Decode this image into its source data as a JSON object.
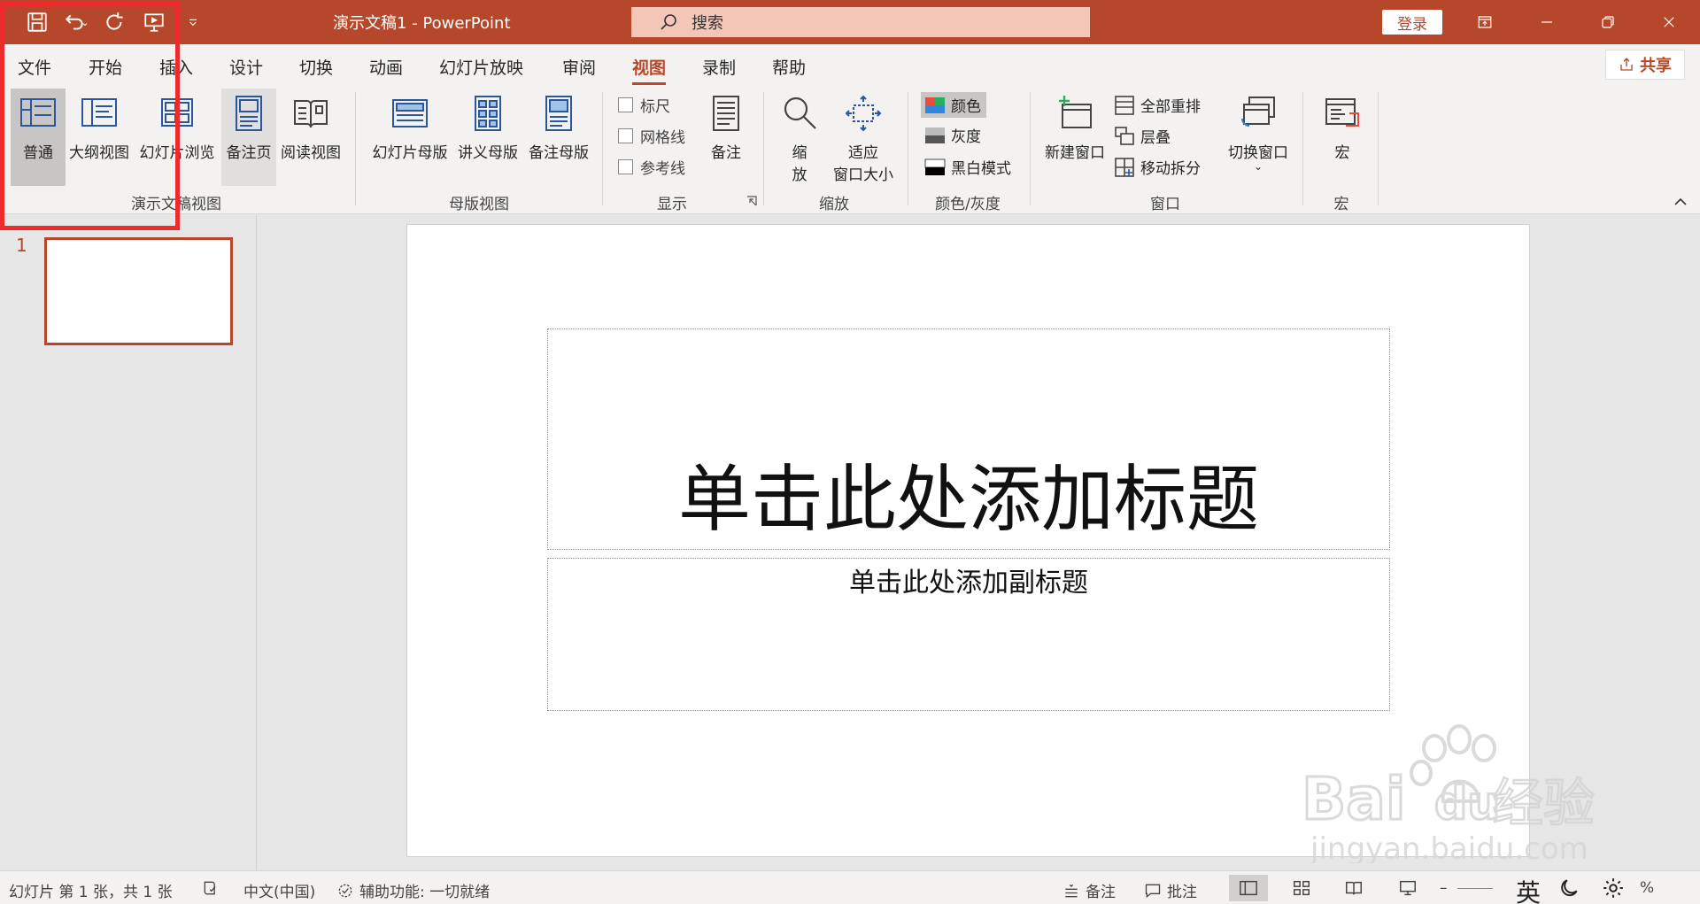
{
  "titlebar": {
    "doc_title": "演示文稿1  -  PowerPoint",
    "search_placeholder": "搜索",
    "login_label": "登录"
  },
  "tabs": [
    {
      "label": "文件"
    },
    {
      "label": "开始"
    },
    {
      "label": "插入"
    },
    {
      "label": "设计"
    },
    {
      "label": "切换"
    },
    {
      "label": "动画"
    },
    {
      "label": "幻灯片放映"
    },
    {
      "label": "审阅"
    },
    {
      "label": "视图",
      "active": true
    },
    {
      "label": "录制"
    },
    {
      "label": "帮助"
    }
  ],
  "share_label": "共享",
  "ribbon": {
    "presentation_views": {
      "label": "演示文稿视图",
      "buttons": [
        "普通",
        "大纲视图",
        "幻灯片浏览",
        "备注页",
        "阅读视图"
      ]
    },
    "master_views": {
      "label": "母版视图",
      "buttons": [
        "幻灯片母版",
        "讲义母版",
        "备注母版"
      ]
    },
    "show": {
      "label": "显示",
      "checkboxes": [
        "标尺",
        "网格线",
        "参考线"
      ],
      "notes_button": "备注"
    },
    "zoom": {
      "label": "缩放",
      "zoom_button_line1": "缩",
      "zoom_button_line2": "放",
      "fit_button_line1": "适应",
      "fit_button_line2": "窗口大小"
    },
    "color": {
      "label": "颜色/灰度",
      "options": [
        "颜色",
        "灰度",
        "黑白模式"
      ]
    },
    "window": {
      "label": "窗口",
      "new_window": "新建窗口",
      "arrange_all": "全部重排",
      "cascade": "层叠",
      "move_split": "移动拆分",
      "switch_windows": "切换窗口"
    },
    "macros": {
      "label": "宏",
      "button": "宏"
    }
  },
  "thumbnails": [
    {
      "number": "1"
    }
  ],
  "slide": {
    "title_placeholder": "单击此处添加标题",
    "subtitle_placeholder": "单击此处添加副标题"
  },
  "statusbar": {
    "slide_info": "幻灯片 第 1 张，共 1 张",
    "language": "中文(中国)",
    "accessibility": "辅助功能: 一切就绪",
    "notes": "备注",
    "comments": "批注",
    "zoom_suffix": "%",
    "ime_label": "英"
  },
  "colors": {
    "accent": "#b7472a",
    "ribbon_bg": "#f3f2f1",
    "annotation_red": "#ee2a2a"
  }
}
